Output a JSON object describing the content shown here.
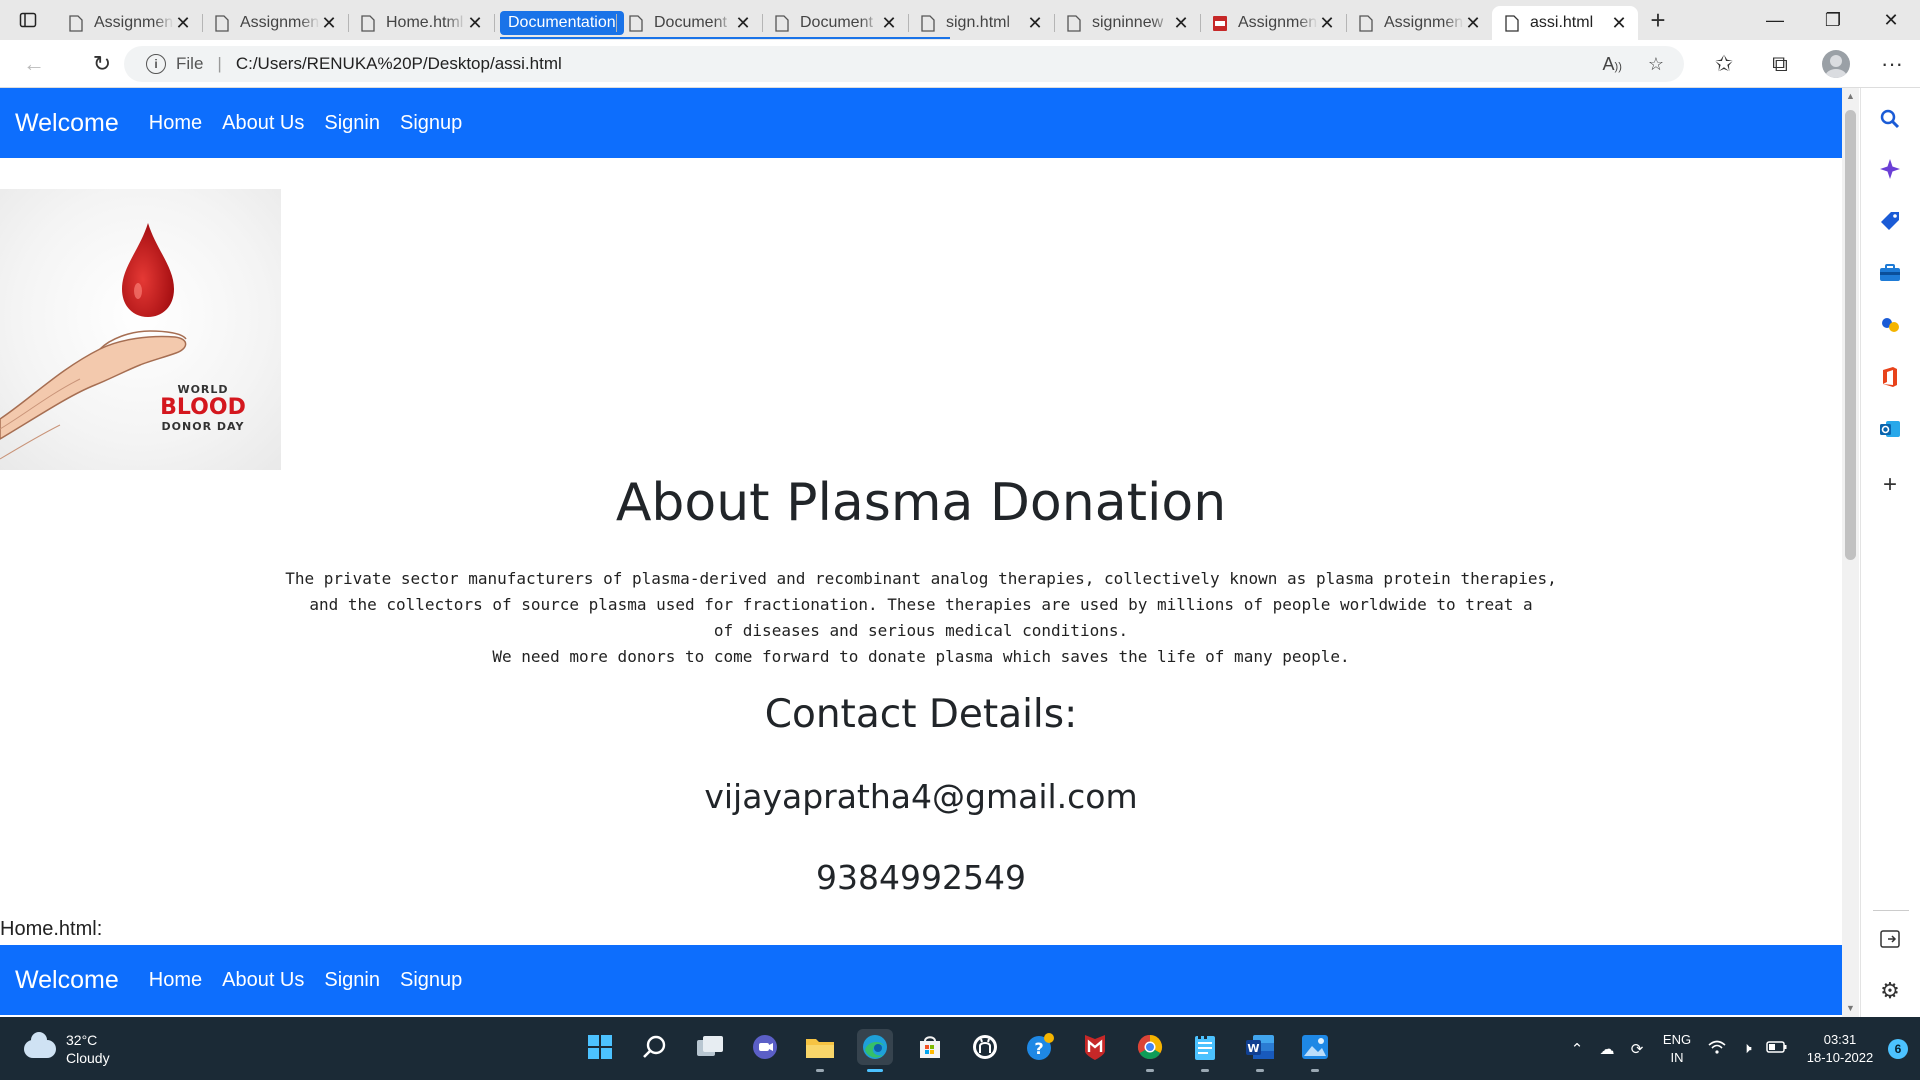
{
  "browser": {
    "tabs": [
      {
        "label": "Assignment",
        "icon": "page-icon"
      },
      {
        "label": "Assignment",
        "icon": "page-icon"
      },
      {
        "label": "Home.html",
        "icon": "page-icon"
      },
      {
        "label": "Documentation",
        "icon": "tab-group-chip",
        "group": true
      },
      {
        "label": "Document",
        "icon": "page-icon"
      },
      {
        "label": "Document",
        "icon": "page-icon"
      },
      {
        "label": "sign.html",
        "icon": "page-icon"
      },
      {
        "label": "signinnew",
        "icon": "page-icon"
      },
      {
        "label": "Assignment",
        "icon": "pdf-icon"
      },
      {
        "label": "Assignment",
        "icon": "page-icon"
      },
      {
        "label": "assi.html",
        "icon": "page-icon",
        "active": true
      }
    ],
    "close_glyph": "✕",
    "new_tab_glyph": "+",
    "address": {
      "scheme_label": "File",
      "separator": "|",
      "url": "C:/Users/RENUKA%20P/Desktop/assi.html"
    },
    "accent": "#1a73e8"
  },
  "page": {
    "nav": {
      "brand": "Welcome",
      "links": [
        "Home",
        "About Us",
        "Signin",
        "Signup"
      ],
      "color": "#0d6efd"
    },
    "image_caption": {
      "line1": "WORLD",
      "line2": "BLOOD",
      "line3": "DONOR DAY"
    },
    "title": "About Plasma Donation",
    "paragraph_lines": [
      "The private sector manufacturers of plasma-derived and recombinant analog therapies, collectively known as plasma protein therapies,",
      "and the collectors of source plasma used for fractionation. These therapies are used by millions of people worldwide to treat a",
      "of diseases and serious medical conditions.",
      "We need more donors to come forward to donate plasma which saves the life of many people."
    ],
    "contact_heading": "Contact Details:",
    "email": "vijayapratha4@gmail.com",
    "phone": "9384992549",
    "section_label": "Home.html:"
  },
  "taskbar": {
    "weather": {
      "temp": "32°C",
      "condition": "Cloudy"
    },
    "apps": [
      "windows-start-icon",
      "search-icon",
      "task-view-icon",
      "teams-chat-icon",
      "file-explorer-icon",
      "edge-icon",
      "microsoft-store-icon",
      "github-desktop-icon",
      "help-icon",
      "mcafee-icon",
      "chrome-icon",
      "notepad-icon",
      "word-icon",
      "photos-icon"
    ],
    "language": {
      "line1": "ENG",
      "line2": "IN"
    },
    "clock": {
      "time": "03:31",
      "date": "18-10-2022"
    },
    "notification_count": "6"
  }
}
